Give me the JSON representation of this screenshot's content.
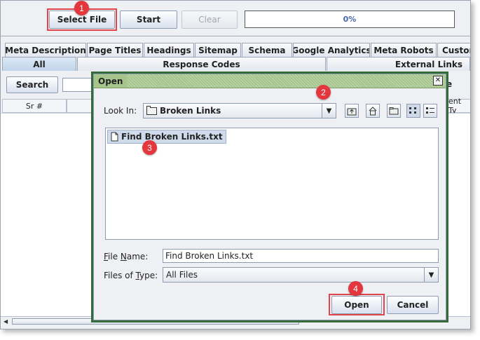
{
  "toolbar": {
    "select_file": "Select File",
    "start": "Start",
    "clear": "Clear",
    "progress": "0%"
  },
  "tabs_row1": [
    "Meta Description",
    "Page Titles",
    "Headings",
    "Sitemap",
    "Schema",
    "Google Analytics",
    "Meta Robots",
    "Custom"
  ],
  "tabs_row2": [
    "All",
    "Response Codes",
    "External Links"
  ],
  "search": {
    "button": "Search",
    "value": ""
  },
  "table": {
    "headers": [
      "Sr #",
      "ent Ty"
    ],
    "trailing_label": "e"
  },
  "dialog": {
    "title": "Open",
    "look_in_label": "Look In:",
    "look_in_value": "Broken Links",
    "files": [
      "Find Broken Links.txt"
    ],
    "file_name_label": "File Name:",
    "file_name_value": "Find Broken Links.txt",
    "files_of_type_label": "Files of Type:",
    "files_of_type_value": "All Files",
    "open_button": "Open",
    "cancel_button": "Cancel"
  },
  "badges": [
    "1",
    "2",
    "3",
    "4"
  ],
  "colors": {
    "highlight": "#e0454b",
    "badge": "#e4373d",
    "dialog_border": "#356a3a",
    "titlebar": "#a6c58d"
  },
  "icons": [
    "folder-icon",
    "up-one-level-icon",
    "home-icon",
    "new-folder-icon",
    "list-view-icon",
    "details-view-icon",
    "file-icon",
    "dropdown-arrow-icon",
    "close-icon"
  ]
}
